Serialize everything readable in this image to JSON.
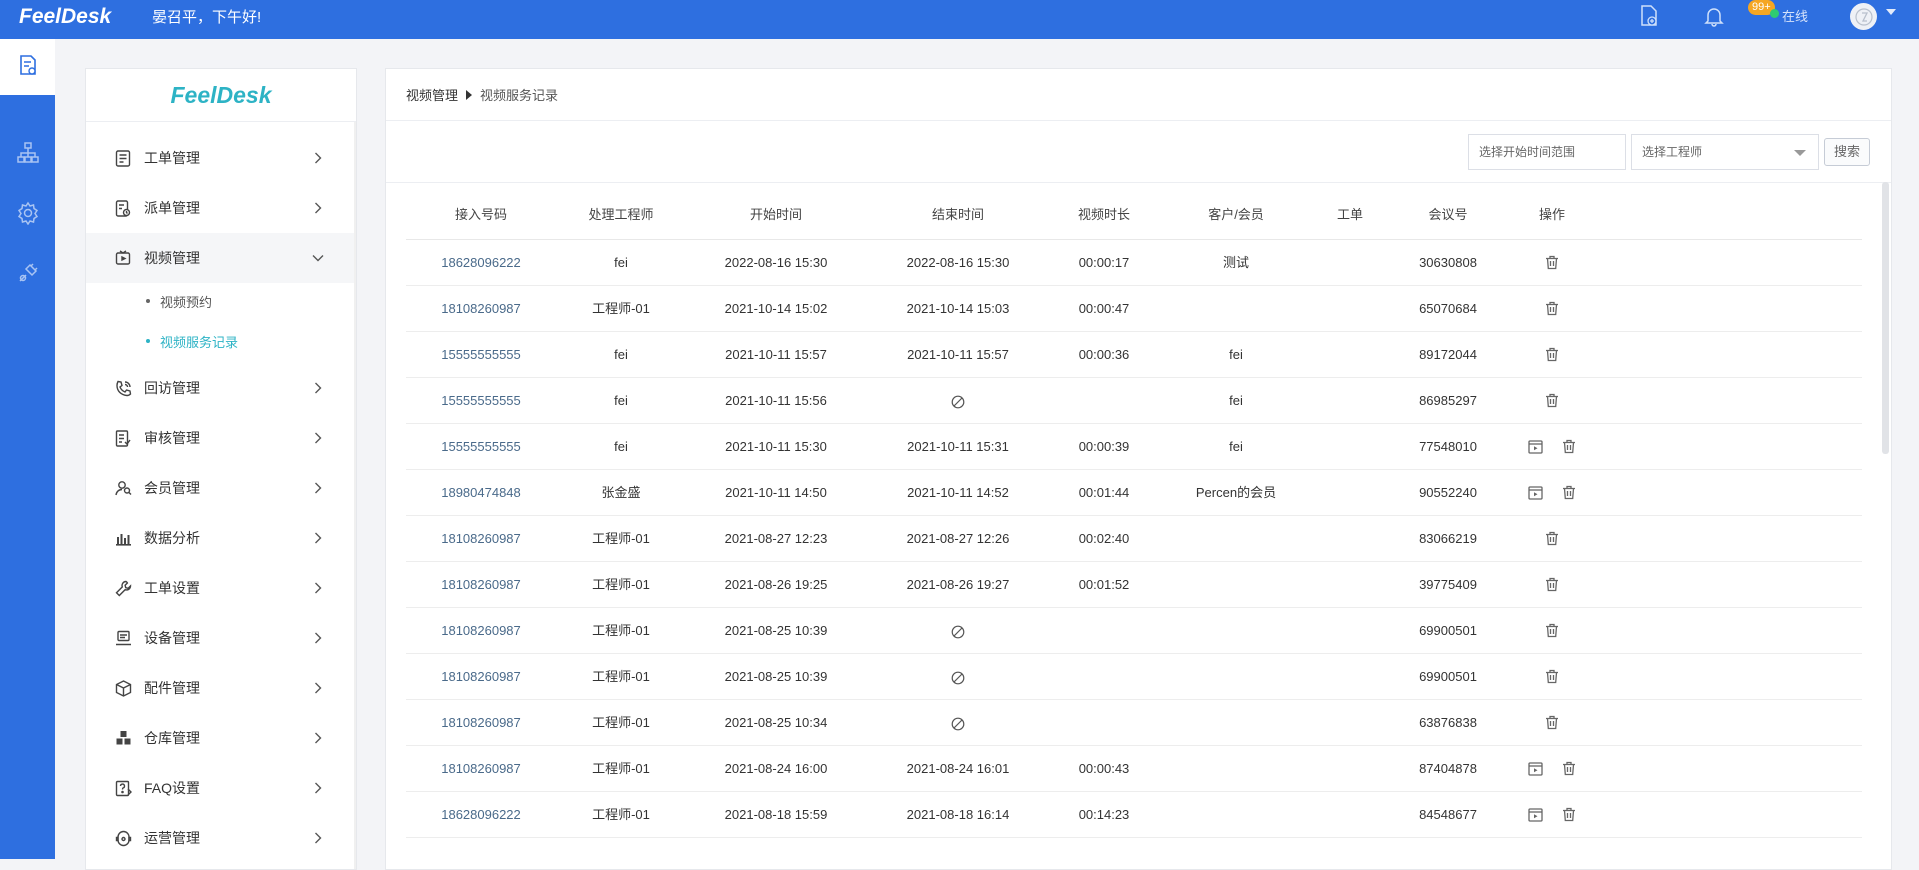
{
  "topbar": {
    "logo": "FeelDesk",
    "greeting": "晏召平，下午好!",
    "notification_count": "99+",
    "status": "在线"
  },
  "sidebar": {
    "logo": "FeelDesk",
    "menu": [
      {
        "label": "工单管理",
        "icon": "ticket-icon"
      },
      {
        "label": "派单管理",
        "icon": "dispatch-icon"
      },
      {
        "label": "视频管理",
        "icon": "video-icon",
        "expanded": true
      },
      {
        "label": "回访管理",
        "icon": "phone-icon"
      },
      {
        "label": "审核管理",
        "icon": "review-icon"
      },
      {
        "label": "会员管理",
        "icon": "members-icon"
      },
      {
        "label": "数据分析",
        "icon": "chart-icon"
      },
      {
        "label": "工单设置",
        "icon": "wrench-icon"
      },
      {
        "label": "设备管理",
        "icon": "device-icon"
      },
      {
        "label": "配件管理",
        "icon": "box-icon"
      },
      {
        "label": "仓库管理",
        "icon": "warehouse-icon"
      },
      {
        "label": "FAQ设置",
        "icon": "faq-icon"
      },
      {
        "label": "运营管理",
        "icon": "operations-icon"
      }
    ],
    "submenu": [
      "视频预约",
      "视频服务记录"
    ]
  },
  "breadcrumb": {
    "parent": "视频管理",
    "current": "视频服务记录"
  },
  "filters": {
    "date_placeholder": "选择开始时间范围",
    "engineer_placeholder": "选择工程师",
    "search_label": "搜索"
  },
  "table": {
    "headers": [
      "接入号码",
      "处理工程师",
      "开始时间",
      "结束时间",
      "视频时长",
      "客户/会员",
      "工单",
      "会议号",
      "操作"
    ],
    "rows": [
      {
        "phone": "18628096222",
        "engineer": "fei",
        "start": "2022-08-16 15:30",
        "end": "2022-08-16 15:30",
        "duration": "00:00:17",
        "customer": "测试",
        "ticket": "",
        "meeting": "30630808",
        "playback": false
      },
      {
        "phone": "18108260987",
        "engineer": "工程师-01",
        "start": "2021-10-14 15:02",
        "end": "2021-10-14 15:03",
        "duration": "00:00:47",
        "customer": "",
        "ticket": "",
        "meeting": "65070684",
        "playback": false
      },
      {
        "phone": "15555555555",
        "engineer": "fei",
        "start": "2021-10-11 15:57",
        "end": "2021-10-11 15:57",
        "duration": "00:00:36",
        "customer": "fei",
        "ticket": "",
        "meeting": "89172044",
        "playback": false
      },
      {
        "phone": "15555555555",
        "engineer": "fei",
        "start": "2021-10-11 15:56",
        "end": null,
        "duration": "",
        "customer": "fei",
        "ticket": "",
        "meeting": "86985297",
        "playback": false
      },
      {
        "phone": "15555555555",
        "engineer": "fei",
        "start": "2021-10-11 15:30",
        "end": "2021-10-11 15:31",
        "duration": "00:00:39",
        "customer": "fei",
        "ticket": "",
        "meeting": "77548010",
        "playback": true
      },
      {
        "phone": "18980474848",
        "engineer": "张金盛",
        "start": "2021-10-11 14:50",
        "end": "2021-10-11 14:52",
        "duration": "00:01:44",
        "customer": "Percen的会员",
        "ticket": "",
        "meeting": "90552240",
        "playback": true
      },
      {
        "phone": "18108260987",
        "engineer": "工程师-01",
        "start": "2021-08-27 12:23",
        "end": "2021-08-27 12:26",
        "duration": "00:02:40",
        "customer": "",
        "ticket": "",
        "meeting": "83066219",
        "playback": false
      },
      {
        "phone": "18108260987",
        "engineer": "工程师-01",
        "start": "2021-08-26 19:25",
        "end": "2021-08-26 19:27",
        "duration": "00:01:52",
        "customer": "",
        "ticket": "",
        "meeting": "39775409",
        "playback": false
      },
      {
        "phone": "18108260987",
        "engineer": "工程师-01",
        "start": "2021-08-25 10:39",
        "end": null,
        "duration": "",
        "customer": "",
        "ticket": "",
        "meeting": "69900501",
        "playback": false
      },
      {
        "phone": "18108260987",
        "engineer": "工程师-01",
        "start": "2021-08-25 10:39",
        "end": null,
        "duration": "",
        "customer": "",
        "ticket": "",
        "meeting": "69900501",
        "playback": false
      },
      {
        "phone": "18108260987",
        "engineer": "工程师-01",
        "start": "2021-08-25 10:34",
        "end": null,
        "duration": "",
        "customer": "",
        "ticket": "",
        "meeting": "63876838",
        "playback": false
      },
      {
        "phone": "18108260987",
        "engineer": "工程师-01",
        "start": "2021-08-24 16:00",
        "end": "2021-08-24 16:01",
        "duration": "00:00:43",
        "customer": "",
        "ticket": "",
        "meeting": "87404878",
        "playback": true
      },
      {
        "phone": "18628096222",
        "engineer": "工程师-01",
        "start": "2021-08-18 15:59",
        "end": "2021-08-18 16:14",
        "duration": "00:14:23",
        "customer": "",
        "ticket": "",
        "meeting": "84548677",
        "playback": true
      }
    ]
  },
  "colors": {
    "primary": "#2e6fe0",
    "accent": "#2db3c5",
    "badge": "#f5a623",
    "online": "#2ecc71"
  }
}
